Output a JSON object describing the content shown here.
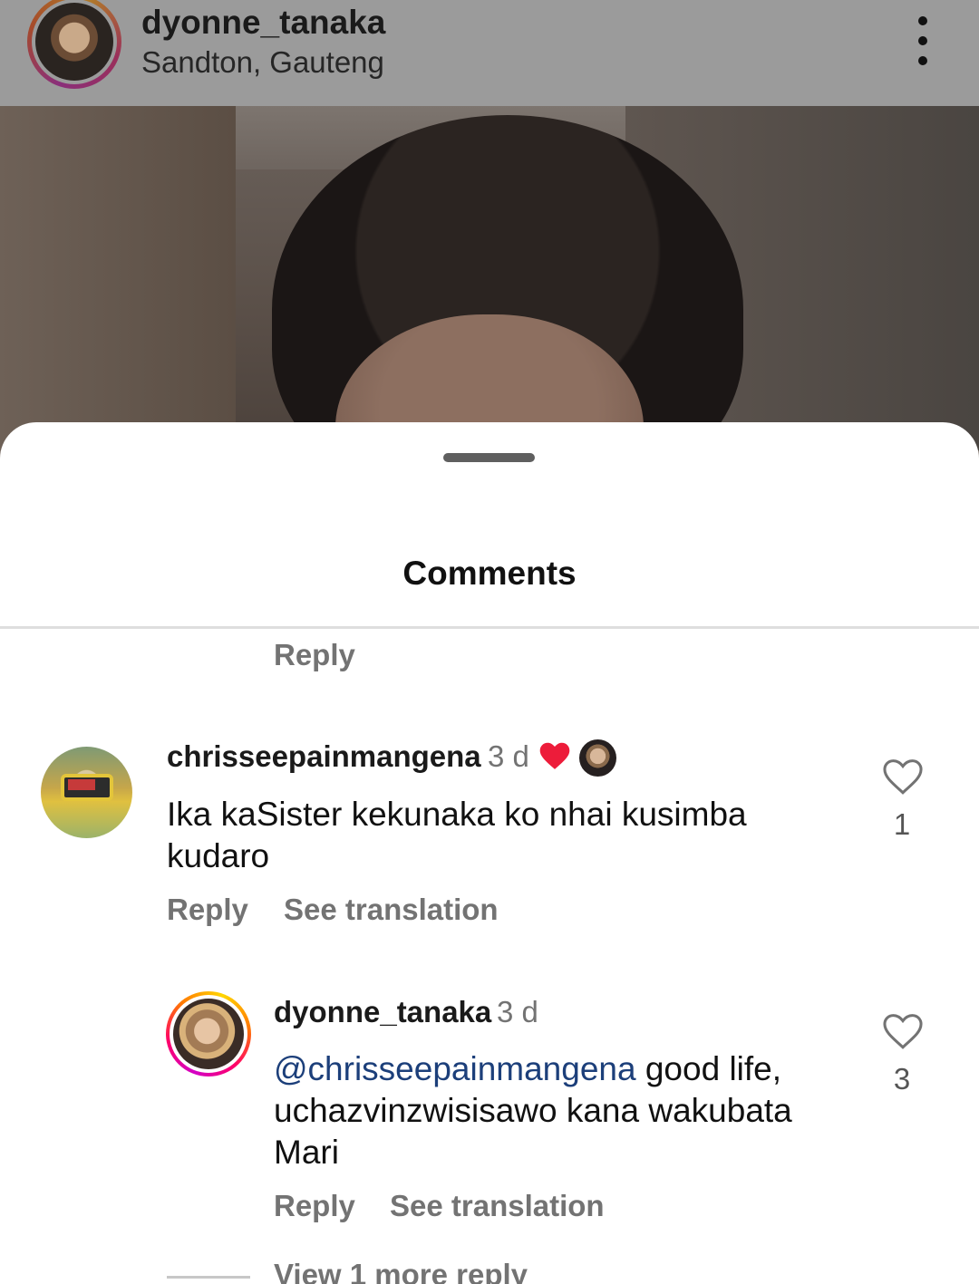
{
  "post": {
    "username": "dyonne_tanaka",
    "location": "Sandton, Gauteng",
    "more_icon": "vertical-ellipsis-icon"
  },
  "sheet": {
    "title": "Comments"
  },
  "previous_comment": {
    "reply_label": "Reply"
  },
  "comments": [
    {
      "username": "chrisseepainmangena",
      "time": "3 d",
      "text": "Ika kaSister kekunaka ko nhai kusimba kudaro",
      "reply_label": "Reply",
      "translate_label": "See translation",
      "likes": "1",
      "liked_by_author": true,
      "heart_color": "#ed1c3a"
    },
    {
      "username": "dyonne_tanaka",
      "time": "3 d",
      "mention": "@chrisseepainmangena",
      "text": " good life, uchazvinzwisisawo kana wakubata Mari",
      "reply_label": "Reply",
      "translate_label": "See translation",
      "likes": "3",
      "view_more": "View 1 more reply"
    }
  ],
  "colors": {
    "mention": "#1c3f7a",
    "secondary_text": "#737373",
    "heart_red": "#ed1c3a"
  }
}
